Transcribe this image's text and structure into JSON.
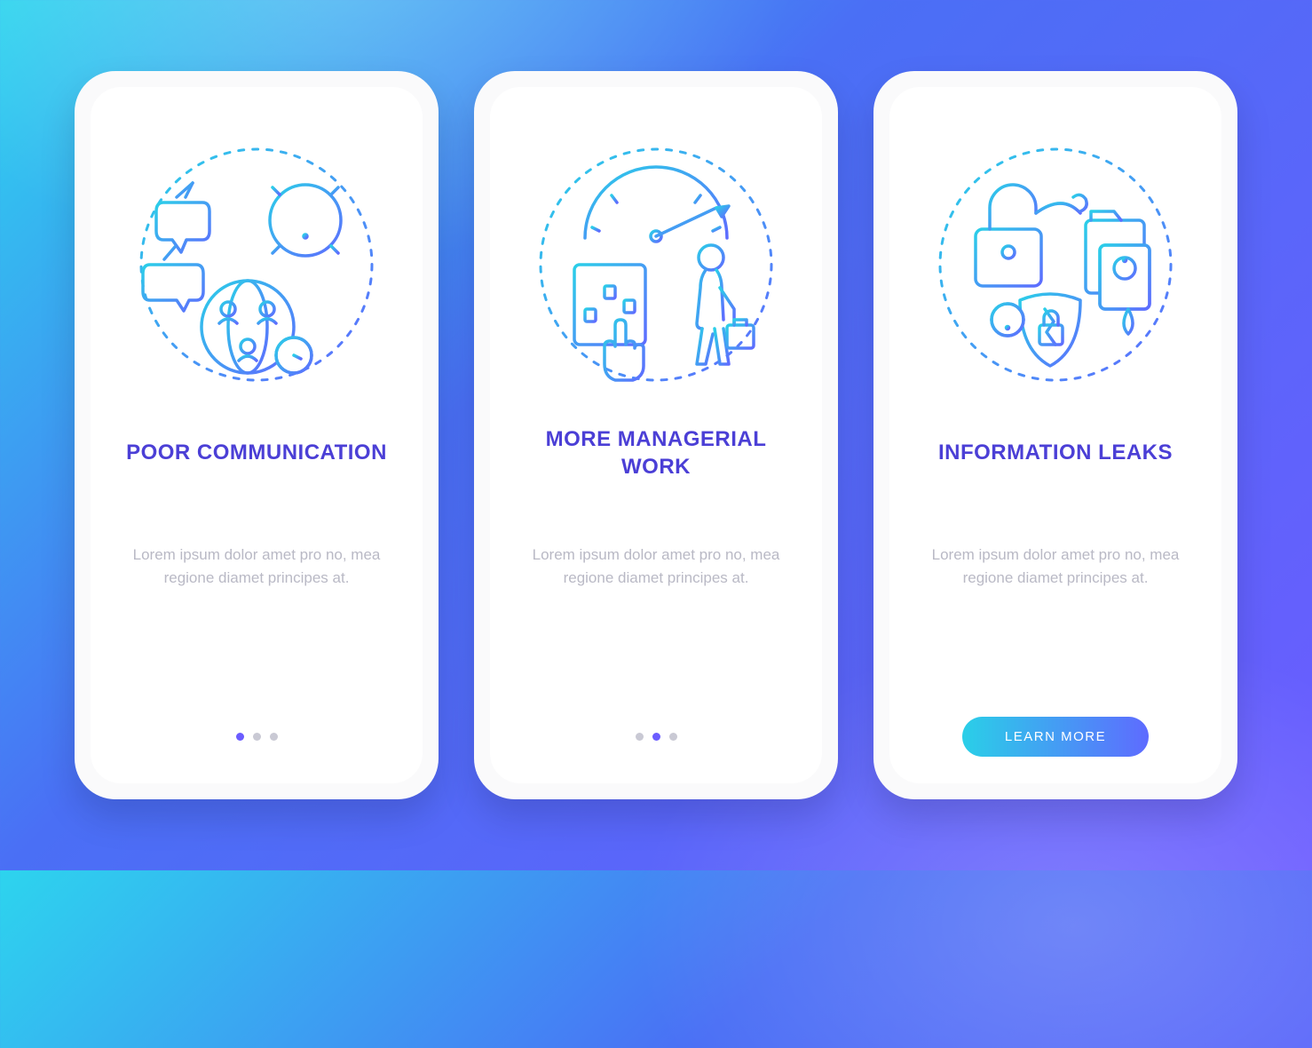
{
  "screens": [
    {
      "title": "POOR COMMUNICATION",
      "description": "Lorem ipsum dolor amet pro no, mea regione diamet principes at.",
      "active_dot": 0
    },
    {
      "title": "MORE MANAGERIAL\nWORK",
      "description": "Lorem ipsum dolor amet pro no, mea regione diamet principes at.",
      "active_dot": 1
    },
    {
      "title": "INFORMATION LEAKS",
      "description": "Lorem ipsum dolor amet pro no, mea regione diamet principes at.",
      "cta_label": "LEARN MORE"
    }
  ],
  "icons": {
    "screen0": "communication-breakdown-icon",
    "screen1": "managerial-overload-icon",
    "screen2": "information-leak-icon"
  },
  "colors": {
    "title": "#4b3fd6",
    "grad_start": "#2acfe8",
    "grad_end": "#5e6bff"
  }
}
